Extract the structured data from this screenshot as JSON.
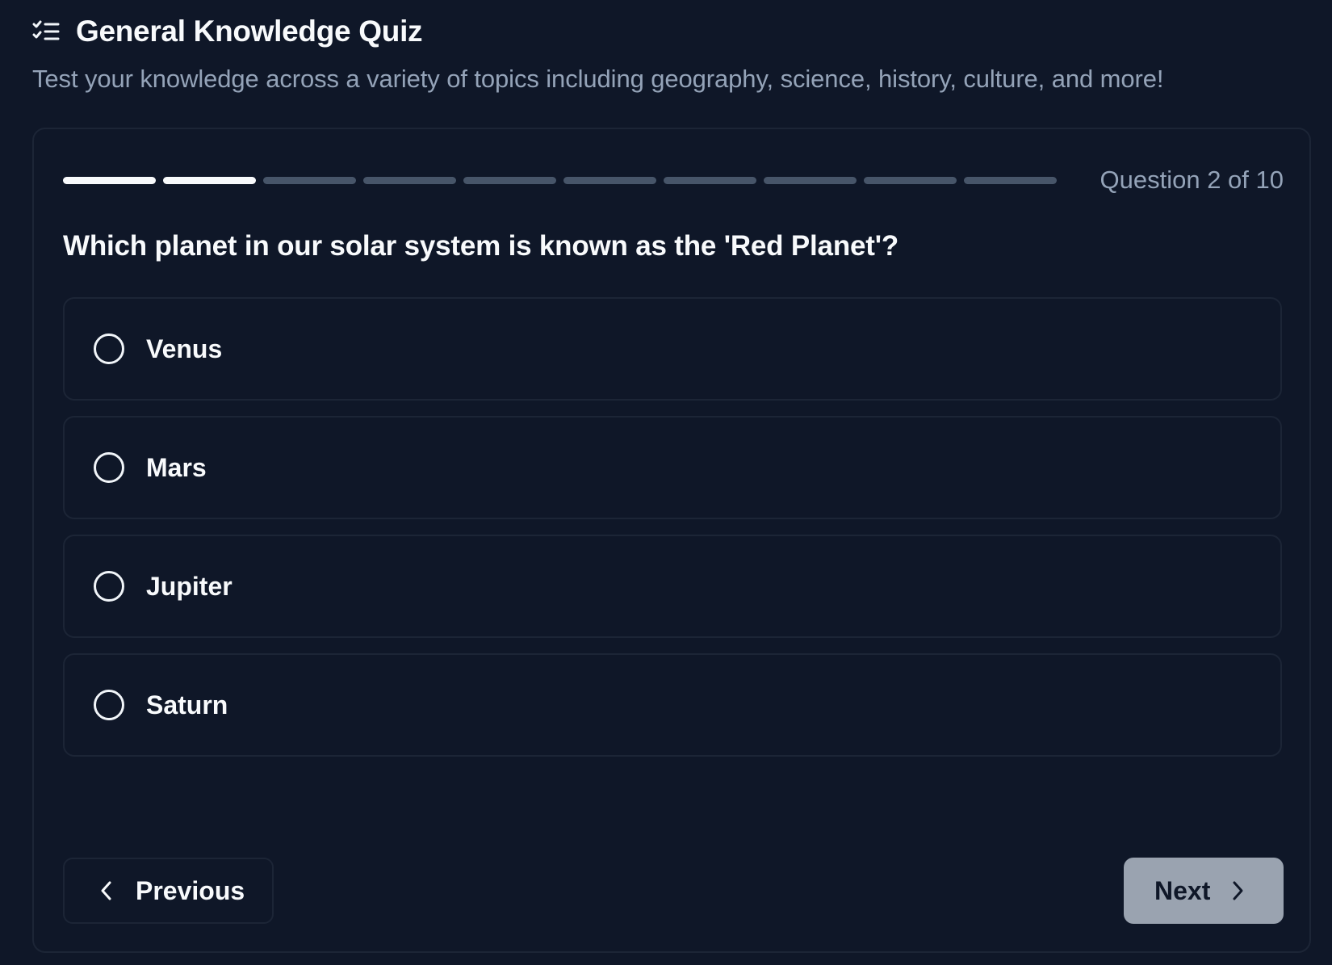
{
  "header": {
    "title": "General Knowledge Quiz",
    "subtitle": "Test your knowledge across a variety of topics including geography, science, history, culture, and more!",
    "icon": "checklist-icon"
  },
  "progress": {
    "current_question": 2,
    "total_questions": 10,
    "label": "Question 2 of 10"
  },
  "question": {
    "text": "Which planet in our solar system is known as the 'Red Planet'?",
    "options": [
      {
        "label": "Venus",
        "selected": false
      },
      {
        "label": "Mars",
        "selected": false
      },
      {
        "label": "Jupiter",
        "selected": false
      },
      {
        "label": "Saturn",
        "selected": false
      }
    ]
  },
  "navigation": {
    "previous_label": "Previous",
    "previous_icon": "chevron-left-icon",
    "next_label": "Next",
    "next_icon": "chevron-right-icon"
  },
  "colors": {
    "background": "#0f1728",
    "border": "#1c2536",
    "text": "#f8fafc",
    "muted_text": "#94a3b8",
    "progress_done": "#f8fafc",
    "progress_pending": "#475569",
    "next_button_bg": "#9aa3b0"
  }
}
